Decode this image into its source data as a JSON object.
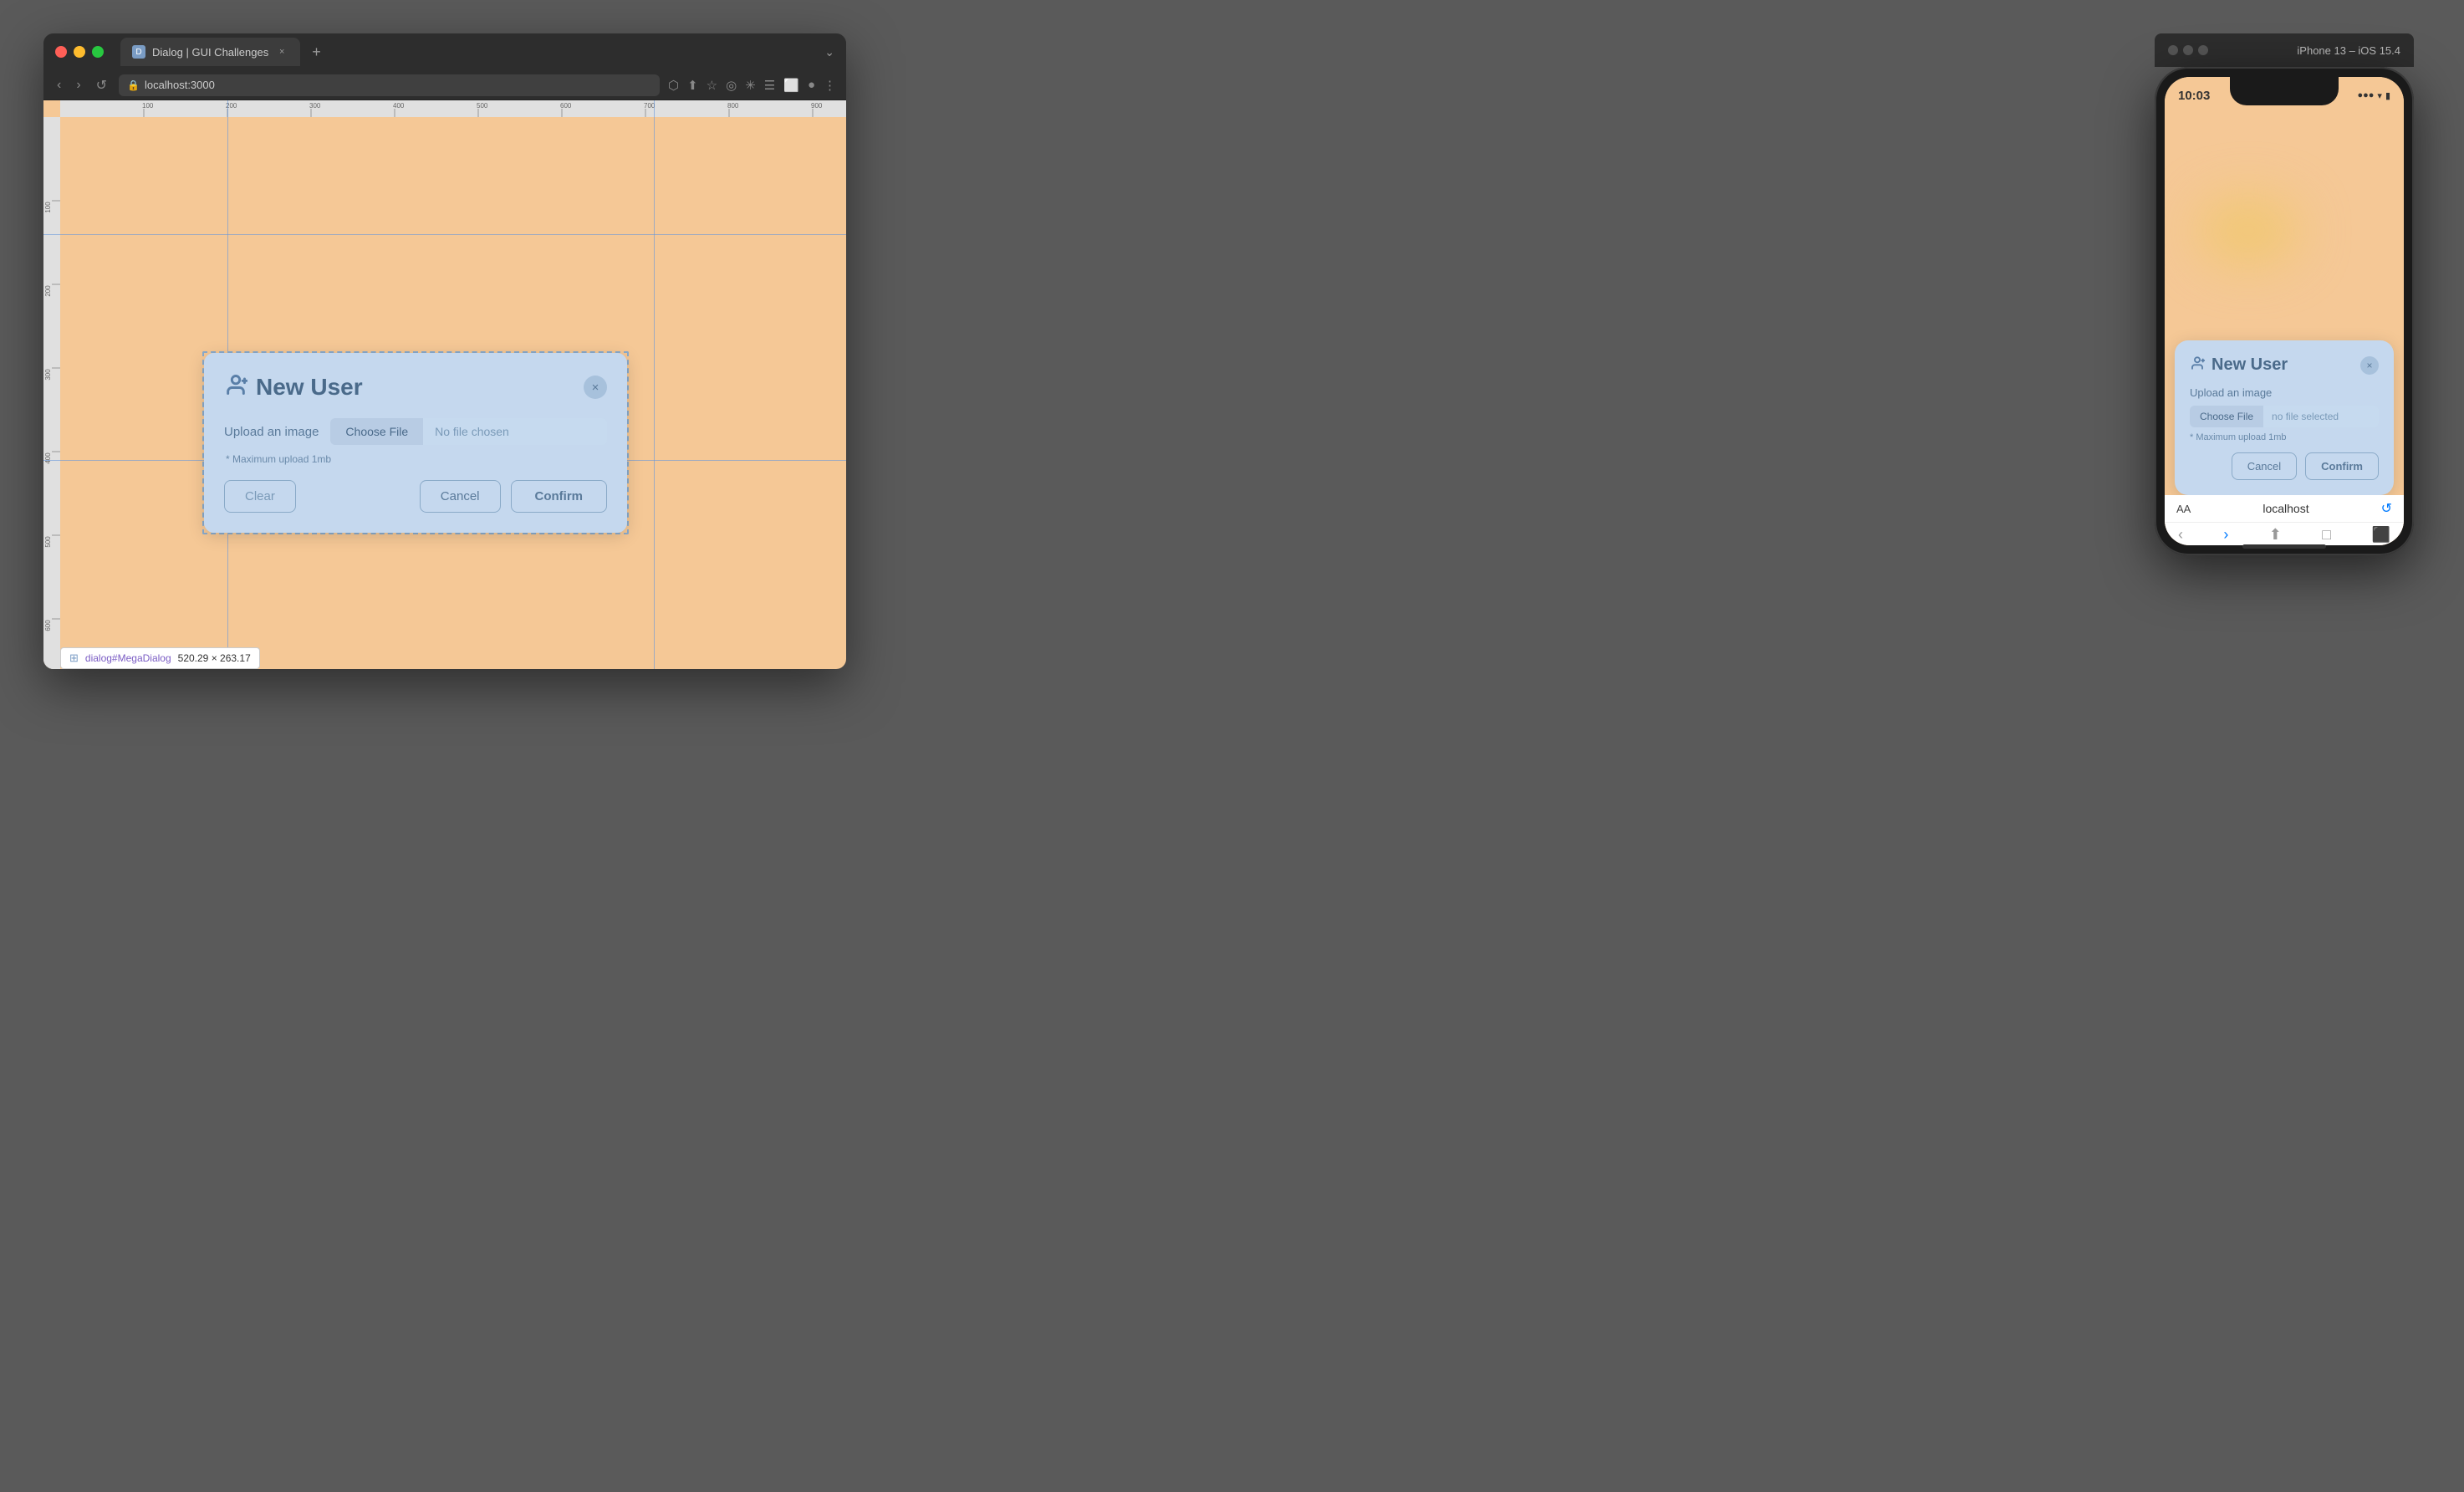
{
  "browser": {
    "tab_title": "Dialog | GUI Challenges",
    "url": "localhost:3000",
    "traffic_lights": [
      "red",
      "yellow",
      "green"
    ],
    "tab_plus": "+",
    "nav": {
      "back": "‹",
      "forward": "›",
      "reload": "↺",
      "lock_icon": "🔒"
    },
    "toolbar_icons": [
      "⬡",
      "⬆",
      "☆",
      "◎",
      "✳",
      "☰",
      "⬜",
      "●",
      "⋮"
    ]
  },
  "dialog": {
    "title": "New User",
    "upload_label": "Upload an image",
    "choose_file_btn": "Choose File",
    "no_file_text": "No file chosen",
    "max_upload_note": "* Maximum upload 1mb",
    "clear_btn": "Clear",
    "cancel_btn": "Cancel",
    "confirm_btn": "Confirm",
    "close_btn": "×"
  },
  "iphone": {
    "device_title": "iPhone 13 – iOS 15.4",
    "time": "10:03",
    "status": "... ▼ WiFi Battery",
    "dialog": {
      "title": "New User",
      "upload_label": "Upload an image",
      "choose_file_btn": "Choose File",
      "no_file_text": "no file selected",
      "max_upload_note": "* Maximum upload 1mb",
      "cancel_btn": "Cancel",
      "confirm_btn": "Confirm",
      "close_btn": "×"
    },
    "address_bar": {
      "aa": "AA",
      "url": "localhost"
    }
  },
  "infobar": {
    "selector": "dialog#MegaDialog",
    "dimensions": "520.29 × 263.17"
  },
  "colors": {
    "bg_orange": "#f5c896",
    "dialog_bg": "#c5d8ee",
    "browser_chrome": "#2d2d2d",
    "accent_blue": "#5a7fa8"
  }
}
